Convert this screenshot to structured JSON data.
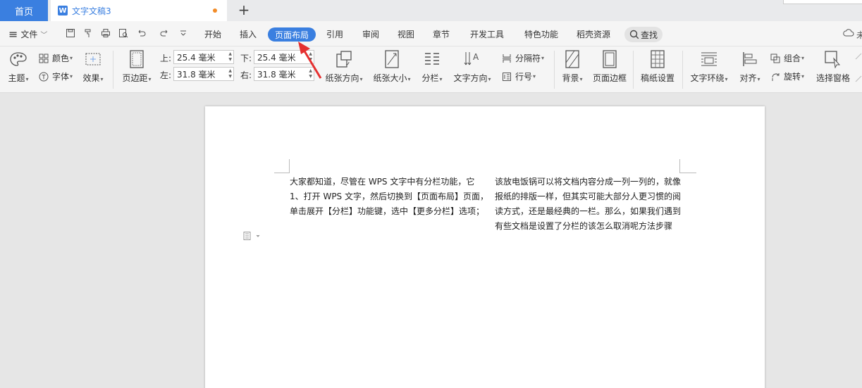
{
  "tabs": {
    "home": "首页",
    "doc_icon": "W",
    "doc_title": "文字文稿3",
    "add": "+"
  },
  "menu": {
    "hamburger": "≡",
    "file": "文件",
    "file_arrow": "﹀",
    "items": [
      "开始",
      "插入",
      "页面布局",
      "引用",
      "审阅",
      "视图",
      "章节",
      "开发工具",
      "特色功能",
      "稻壳资源"
    ],
    "active_item": "页面布局",
    "search": "查找",
    "right_text": "未"
  },
  "ribbon": {
    "theme": "主题",
    "color": "颜色",
    "font": "字体",
    "effect": "效果",
    "margins": "页边距",
    "margin_top_label": "上:",
    "margin_top_value": "25.4 毫米",
    "margin_bottom_label": "下:",
    "margin_bottom_value": "25.4 毫米",
    "margin_left_label": "左:",
    "margin_left_value": "31.8 毫米",
    "margin_right_label": "右:",
    "margin_right_value": "31.8 毫米",
    "orientation": "纸张方向",
    "paper_size": "纸张大小",
    "columns": "分栏",
    "text_direction": "文字方向",
    "separator": "分隔符",
    "line_number": "行号",
    "background": "背景",
    "page_border": "页面边框",
    "manuscript": "稿纸设置",
    "text_wrap": "文字环绕",
    "align": "对齐",
    "group": "组合",
    "rotate": "旋转",
    "selection_pane": "选择窗格"
  },
  "document": {
    "col1": [
      "大家都知道，尽管在 WPS 文字中有分栏功能，它",
      "1、打开 WPS 文字，然后切换到【页面布局】页面，",
      "单击展开【分栏】功能键，选中【更多分栏】选项；"
    ],
    "col2": [
      "该放电饭锅可以将文档内容分成一列一列的，就像",
      "报纸的排版一样，但其实可能大部分人更习惯的阅",
      "读方式，还是最经典的一栏。那么，如果我们遇到",
      "有些文档是设置了分栏的该怎么取消呢方法步骤"
    ]
  },
  "colors": {
    "accent": "#3a7fe0",
    "annotation": "#e53030",
    "modified_dot": "#f28c28"
  }
}
